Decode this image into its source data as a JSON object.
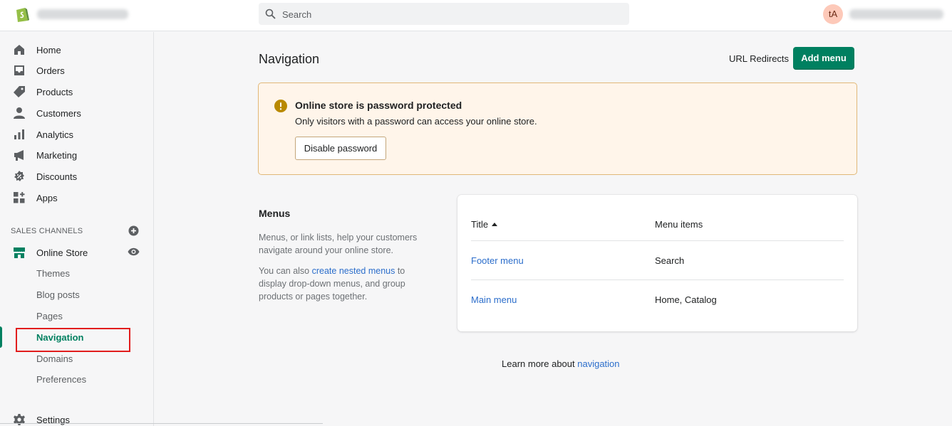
{
  "topbar": {
    "search_placeholder": "Search",
    "avatar_initials": "tA"
  },
  "sidebar": {
    "items": [
      {
        "label": "Home",
        "icon": "home-icon"
      },
      {
        "label": "Orders",
        "icon": "orders-icon"
      },
      {
        "label": "Products",
        "icon": "tag-icon"
      },
      {
        "label": "Customers",
        "icon": "person-icon"
      },
      {
        "label": "Analytics",
        "icon": "bar-chart-icon"
      },
      {
        "label": "Marketing",
        "icon": "megaphone-icon"
      },
      {
        "label": "Discounts",
        "icon": "discount-icon"
      },
      {
        "label": "Apps",
        "icon": "apps-icon"
      }
    ],
    "sales_channels_header": "SALES CHANNELS",
    "online_store": "Online Store",
    "sub_items": [
      "Themes",
      "Blog posts",
      "Pages",
      "Navigation",
      "Domains",
      "Preferences"
    ],
    "settings": "Settings"
  },
  "main": {
    "page_title": "Navigation",
    "url_redirects": "URL Redirects",
    "add_menu": "Add menu",
    "banner": {
      "title": "Online store is password protected",
      "text": "Only visitors with a password can access your online store.",
      "button": "Disable password"
    },
    "menus_section": {
      "title": "Menus",
      "desc1": "Menus, or link lists, help your customers navigate around your online store.",
      "desc2_before": "You can also ",
      "desc2_link": "create nested menus",
      "desc2_after": " to display drop-down menus, and group products or pages together."
    },
    "table": {
      "col_title": "Title",
      "col_items": "Menu items",
      "rows": [
        {
          "title": "Footer menu",
          "items": "Search"
        },
        {
          "title": "Main menu",
          "items": "Home, Catalog"
        }
      ]
    },
    "learn_more_prefix": "Learn more about ",
    "learn_more_link": "navigation"
  },
  "colors": {
    "accent": "#008060",
    "link": "#2c6ecb",
    "warning_bg": "#fff5ea",
    "highlight": "#e11d1d"
  }
}
